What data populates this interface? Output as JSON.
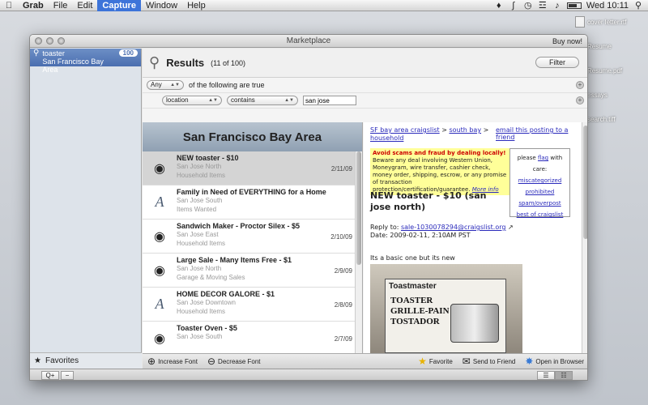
{
  "menubar": {
    "app": "Grab",
    "items": [
      "File",
      "Edit",
      "Capture",
      "Window",
      "Help"
    ],
    "clock": "Wed 10:11"
  },
  "desktop_files": [
    "cover letter.rtf",
    "Resume",
    "Resume.pdf",
    "essays",
    "search.tiff"
  ],
  "window": {
    "title": "Marketplace",
    "buy_now": "Buy now!"
  },
  "sidebar": {
    "search_title": "toaster",
    "search_subtitle": "San Francisco Bay Area",
    "badge": "100",
    "favorites": "Favorites"
  },
  "results": {
    "title": "Results",
    "count": "(11 of 100)",
    "filter_button": "Filter"
  },
  "rules": {
    "match": "Any",
    "match_suffix": "of the following are true",
    "field": "location",
    "operator": "contains",
    "value": "san jose"
  },
  "list": {
    "header": "San Francisco Bay Area",
    "items": [
      {
        "icon": "eye-icon",
        "title": "NEW toaster - $10",
        "loc": "San Jose North",
        "cat": "Household Items",
        "date": "2/11/09"
      },
      {
        "icon": "letter-a-icon",
        "title": "Family in Need of EVERYTHING for a Home",
        "loc": "San Jose South",
        "cat": "Items Wanted",
        "date": ""
      },
      {
        "icon": "eye-icon",
        "title": "Sandwich Maker - Proctor Silex - $5",
        "loc": "San Jose East",
        "cat": "Household Items",
        "date": "2/10/09"
      },
      {
        "icon": "eye-icon",
        "title": "Large Sale - Many Items Free - $1",
        "loc": "San Jose North",
        "cat": "Garage & Moving Sales",
        "date": "2/9/09"
      },
      {
        "icon": "letter-a-icon",
        "title": "HOME DECOR GALORE - $1",
        "loc": "San Jose Downtown",
        "cat": "Household Items",
        "date": "2/8/09"
      },
      {
        "icon": "eye-icon",
        "title": "Toaster Oven - $5",
        "loc": "San Jose South",
        "cat": "",
        "date": "2/7/09"
      }
    ]
  },
  "post": {
    "crumb1": "SF bay area craigslist",
    "crumb_sep": ">",
    "crumb2": "south bay",
    "crumb3": "household",
    "email_link": "email this posting to a friend",
    "warn_red": "Avoid scams and fraud by dealing locally!",
    "warn_text": " Beware any deal involving Western Union, Moneygram, wire transfer, cashier check, money order, shipping, escrow, or any promise of transaction protection/certification/guarantee. ",
    "warn_link": "More info",
    "flag_intro": "please",
    "flag_word": "flag",
    "flag_suffix": "with care:",
    "flags": [
      "miscategorized",
      "prohibited",
      "spam/overpost",
      "best of craigslist"
    ],
    "title": "NEW toaster - $10 (san jose north)",
    "reply_label": "Reply to:",
    "reply_email": "sale-1030078294@craigslist.org",
    "date": "Date: 2009-02-11, 2:10AM PST",
    "description": "Its a basic one but its new",
    "photo_brand": "Toastmaster",
    "photo_lines": [
      "TOASTER",
      "GRILLE-PAIN",
      "TOSTADOR"
    ]
  },
  "toolbar": {
    "increase_font": "Increase Font",
    "decrease_font": "Decrease Font",
    "favorite": "Favorite",
    "send_to_friend": "Send to Friend",
    "open_in_browser": "Open in Browser"
  },
  "statusbar": {
    "add": "Q+",
    "remove": "−"
  },
  "colors": {
    "selection_blue": "#3d74d9",
    "list_header": "#a9b6c4",
    "warning_bg": "#ffff99",
    "link": "#2a2abb"
  }
}
